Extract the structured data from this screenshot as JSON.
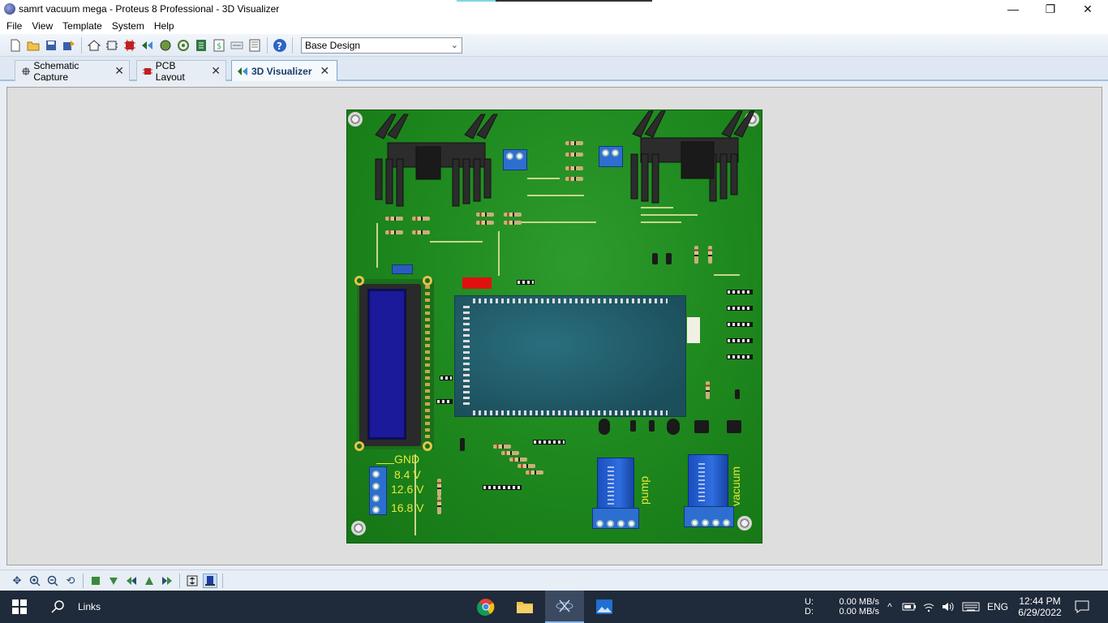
{
  "window": {
    "title": "samrt vacuum mega - Proteus 8 Professional - 3D Visualizer",
    "controls": [
      "—",
      "❐",
      "✕"
    ]
  },
  "menu": [
    "File",
    "View",
    "Template",
    "System",
    "Help"
  ],
  "toolbar": {
    "variant_select": "Base Design",
    "variant_arrow": "⌄"
  },
  "tabs": [
    {
      "label": "Schematic Capture",
      "close": "✕"
    },
    {
      "label": "PCB Layout",
      "close": "✕"
    },
    {
      "label": "3D Visualizer",
      "close": "✕",
      "active": true
    }
  ],
  "board": {
    "labels": {
      "gnd": "GND",
      "v1": "8.4  V",
      "v2": "12.6  V",
      "v3": "16.8  V",
      "pump": "pump",
      "vacuum": "vacuum"
    },
    "colors": {
      "pcb": "#1f8a1f",
      "silk": "#e8e83a",
      "lcd": "#1a1a9a",
      "arduino": "#1c4f5c",
      "relay": "#2f6ee0"
    }
  },
  "taskbar": {
    "search_label": "Links",
    "disk": {
      "u_label": "U:",
      "d_label": "D:",
      "u_val": "0.00 MB/s",
      "d_val": "0.00 MB/s"
    },
    "lang": "ENG",
    "time": "12:44 PM",
    "date": "6/29/2022"
  }
}
